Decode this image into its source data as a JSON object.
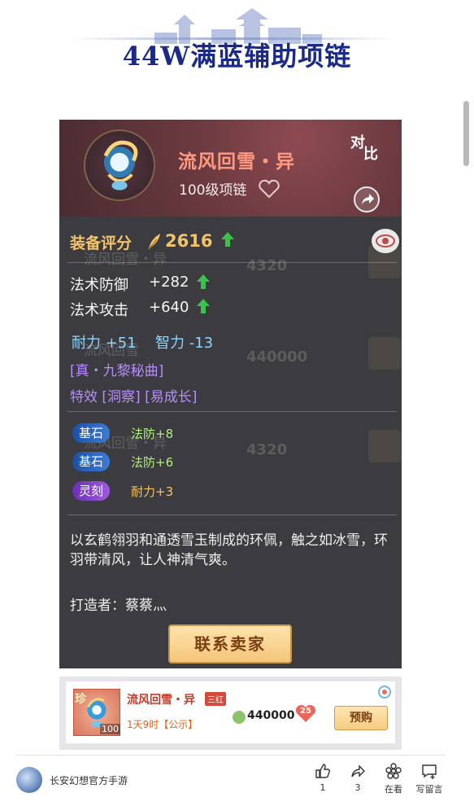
{
  "header": {
    "title": "44W满蓝辅助项链"
  },
  "card": {
    "compare_top": "对",
    "compare_bottom": "比",
    "item_name": "流风回雪・异",
    "item_level": "100级项链",
    "score_label": "装备评分",
    "score_value": "2616",
    "stats": [
      {
        "label": "法术防御",
        "value": "+282"
      },
      {
        "label": "法术攻击",
        "value": "+640"
      }
    ],
    "attrs": {
      "endurance": "耐力 +51",
      "intellect": "智力 -13"
    },
    "spell": "[真・九黎秘曲]",
    "effects": "特效 [洞察] [易成长]",
    "gems": [
      {
        "name": "基石",
        "effect": "法防+8"
      },
      {
        "name": "基石",
        "effect": "法防+6"
      },
      {
        "name": "灵刻",
        "effect": "耐力+3"
      }
    ],
    "description": "以玄鹤翎羽和通透雪玉制成的环佩，触之如冰雪，环羽带清风，让人神清气爽。",
    "maker": "打造者：蔡蔡灬",
    "contact_button": "联系卖家",
    "ghost_rows": [
      {
        "name": "流风回雪・异",
        "price": "4320"
      },
      {
        "name": "流风回雪",
        "price": "440000"
      },
      {
        "name": "流风回雪・异",
        "price": "4320"
      }
    ]
  },
  "listing": {
    "rarity": "珍",
    "level": "100",
    "name": "流风回雪・异",
    "badge": "三红",
    "time": "1天9时【公示】",
    "price": "440000",
    "likes": "25",
    "buy_button": "预购"
  },
  "footer": {
    "author": "长安幻想官方手游",
    "actions": [
      {
        "icon": "thumbs-up-icon",
        "label": "1"
      },
      {
        "icon": "share-icon",
        "label": "3"
      },
      {
        "icon": "flower-icon",
        "label": "在看"
      },
      {
        "icon": "comment-icon",
        "label": "写留言"
      }
    ]
  },
  "colors": {
    "title": "#1a2a86",
    "gold": "#f2c36a",
    "item_name": "#ff9a80",
    "attr_blue": "#8fd4ff",
    "spell_purple": "#b58ef7",
    "arrow_green": "#3cc24a"
  }
}
